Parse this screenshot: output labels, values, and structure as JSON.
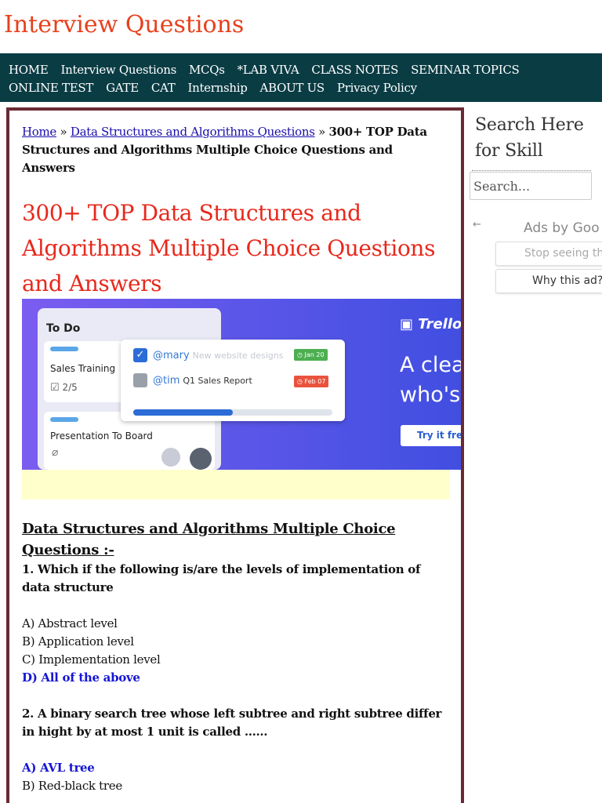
{
  "site": {
    "title": "Interview Questions"
  },
  "nav": {
    "row1": [
      "HOME",
      "Interview Questions",
      "MCQs",
      "*LAB VIVA",
      "CLASS NOTES",
      "SEMINAR TOPICS"
    ],
    "row2": [
      "ONLINE TEST",
      "GATE",
      "CAT",
      "Internship",
      "ABOUT US",
      "Privacy Policy"
    ]
  },
  "breadcrumb": {
    "home": "Home",
    "sep": "»",
    "category": "Data Structures and Algorithms Questions",
    "current": "300+ TOP Data Structures and Algorithms Multiple Choice Questions and Answers"
  },
  "post": {
    "title": "300+ TOP Data Structures and Algorithms Multiple Choice Questions and Answers"
  },
  "ad": {
    "todo_header": "To Do",
    "card1_title": "Sales Training",
    "card1_count": "2/5",
    "card2_title": "Presentation To Board",
    "row1_user": "@mary",
    "row1_task": "New website designs",
    "row1_date": "Jan 20",
    "row2_user": "@tim",
    "row2_task": "Q1 Sales Report",
    "row2_date": "Feb 07",
    "progress": 0.5,
    "brand": "Trello",
    "headline_line1": "A clear",
    "headline_line2": "who's",
    "cta": "Try it free"
  },
  "section": {
    "heading": "Data Structures and Algorithms Multiple Choice Questions :-"
  },
  "q1": {
    "question": "1. Which if the following is/are the levels of implementation of data structure",
    "a": "A) Abstract level",
    "b": "B) Application level",
    "c": "C) Implementation level",
    "d": "D) All of the above"
  },
  "q2": {
    "question": "2. A binary search tree whose left subtree and right subtree differ in hight by at most 1 unit is called ……",
    "a": "A) AVL tree",
    "b": "B) Red-black tree"
  },
  "sidebar": {
    "heading": "Search Here for Skill",
    "search_placeholder": "Search..."
  },
  "google_ads": {
    "back": "←",
    "ads_by": "Ads by Goo",
    "stop": "Stop seeing th",
    "why": "Why this ad?"
  },
  "colors": {
    "brand": "#e8401c",
    "nav_bg": "#0a3c44",
    "box_border": "#6a2a35",
    "answer": "#1515d6"
  }
}
